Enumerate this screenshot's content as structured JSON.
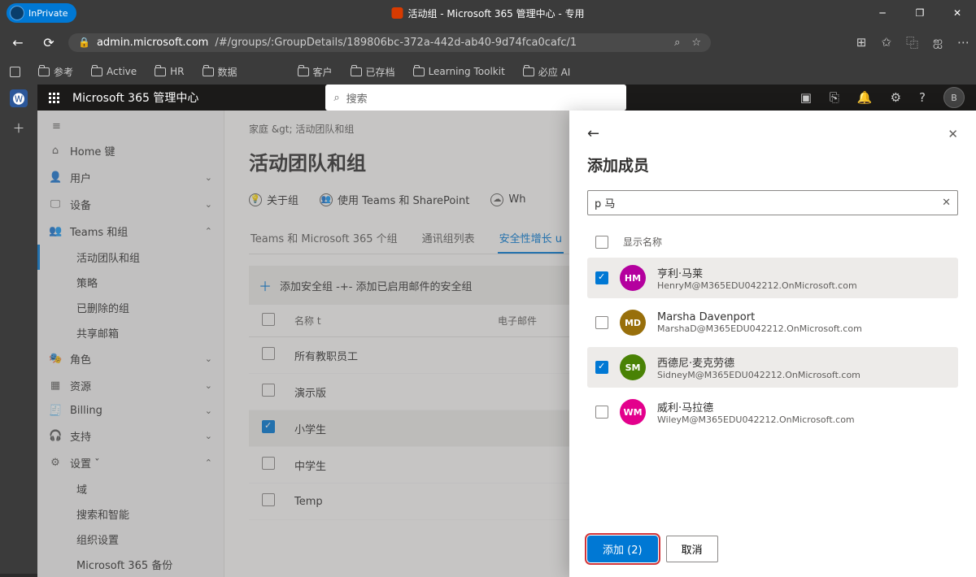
{
  "browser": {
    "inprivate": "InPrivate",
    "title": "活动组 - Microsoft 365 管理中心 - 专用",
    "url_host": "admin.microsoft.com",
    "url_path": "/#/groups/:GroupDetails/189806bc-372a-442d-ab40-9d74fca0cafc/1",
    "bookmarks": [
      "参考",
      "Active",
      "HR",
      "数据",
      "客户",
      "已存档",
      "Learning Toolkit",
      "必应 AI"
    ]
  },
  "header": {
    "app_name": "Microsoft 365 管理中心",
    "search_placeholder": "搜索",
    "avatar": "B"
  },
  "sidebar": {
    "items": [
      {
        "icon": "⌂",
        "label": "Home 键"
      },
      {
        "icon": "👤",
        "label": "用户",
        "chev": "⌄"
      },
      {
        "icon": "🖵",
        "label": "设备",
        "chev": "⌄"
      },
      {
        "icon": "👥",
        "label": "Teams 和组",
        "chev": "⌃",
        "expanded": true,
        "children": [
          {
            "label": "活动团队和组",
            "active": true
          },
          {
            "label": "策略"
          },
          {
            "label": "已删除的组"
          },
          {
            "label": "共享邮箱"
          }
        ]
      },
      {
        "icon": "🎭",
        "label": "角色",
        "chev": "⌄"
      },
      {
        "icon": "▦",
        "label": "资源",
        "chev": "⌄"
      },
      {
        "icon": "🧾",
        "label": "Billing",
        "chev": "⌄"
      },
      {
        "icon": "🎧",
        "label": "支持",
        "chev": "⌄"
      },
      {
        "icon": "⚙",
        "label": "设置 ˇ",
        "chev": "⌃",
        "expanded": true,
        "children": [
          {
            "label": "域"
          },
          {
            "label": "搜索和智能"
          },
          {
            "label": "组织设置"
          },
          {
            "label": "Microsoft 365 备份"
          }
        ]
      }
    ]
  },
  "main": {
    "breadcrumb": "家庭 &gt;   活动团队和组",
    "title": "活动团队和组",
    "helpers": [
      {
        "label": "关于组"
      },
      {
        "label": "使用 Teams 和 SharePoint"
      },
      {
        "label": "Wh"
      }
    ],
    "tabs": [
      "Teams 和  Microsoft 365 个组",
      "通讯组列表",
      "安全性增长  u"
    ],
    "cmdbar": "添加安全组 -+- 添加已启用邮件的安全组",
    "columns": {
      "name": "名称 t",
      "email": "电子邮件"
    },
    "rows": [
      {
        "name": "所有教职员工",
        "checked": false
      },
      {
        "name": "演示版",
        "checked": false
      },
      {
        "name": "小学生",
        "checked": true
      },
      {
        "name": "中学生",
        "checked": false
      },
      {
        "name": "Temp",
        "checked": false
      }
    ]
  },
  "panel": {
    "title": "添加成员",
    "search_value": "p 马",
    "col_display": "显示名称",
    "members": [
      {
        "initials": "HM",
        "color": "#b4009e",
        "name": "亨利·马莱",
        "email": "HenryM@M365EDU042212.OnMicrosoft.com",
        "checked": true
      },
      {
        "initials": "MD",
        "color": "#986f0b",
        "name": "Marsha Davenport",
        "email": "MarshaD@M365EDU042212.OnMicrosoft.com",
        "checked": false
      },
      {
        "initials": "SM",
        "color": "#498205",
        "name": "西德尼·麦克劳德",
        "email": "SidneyM@M365EDU042212.OnMicrosoft.com",
        "checked": true
      },
      {
        "initials": "WM",
        "color": "#e3008c",
        "name": "威利·马拉德",
        "email": "WileyM@M365EDU042212.OnMicrosoft.com",
        "checked": false
      }
    ],
    "add_btn": "添加 (2)",
    "cancel_btn": "取消"
  }
}
